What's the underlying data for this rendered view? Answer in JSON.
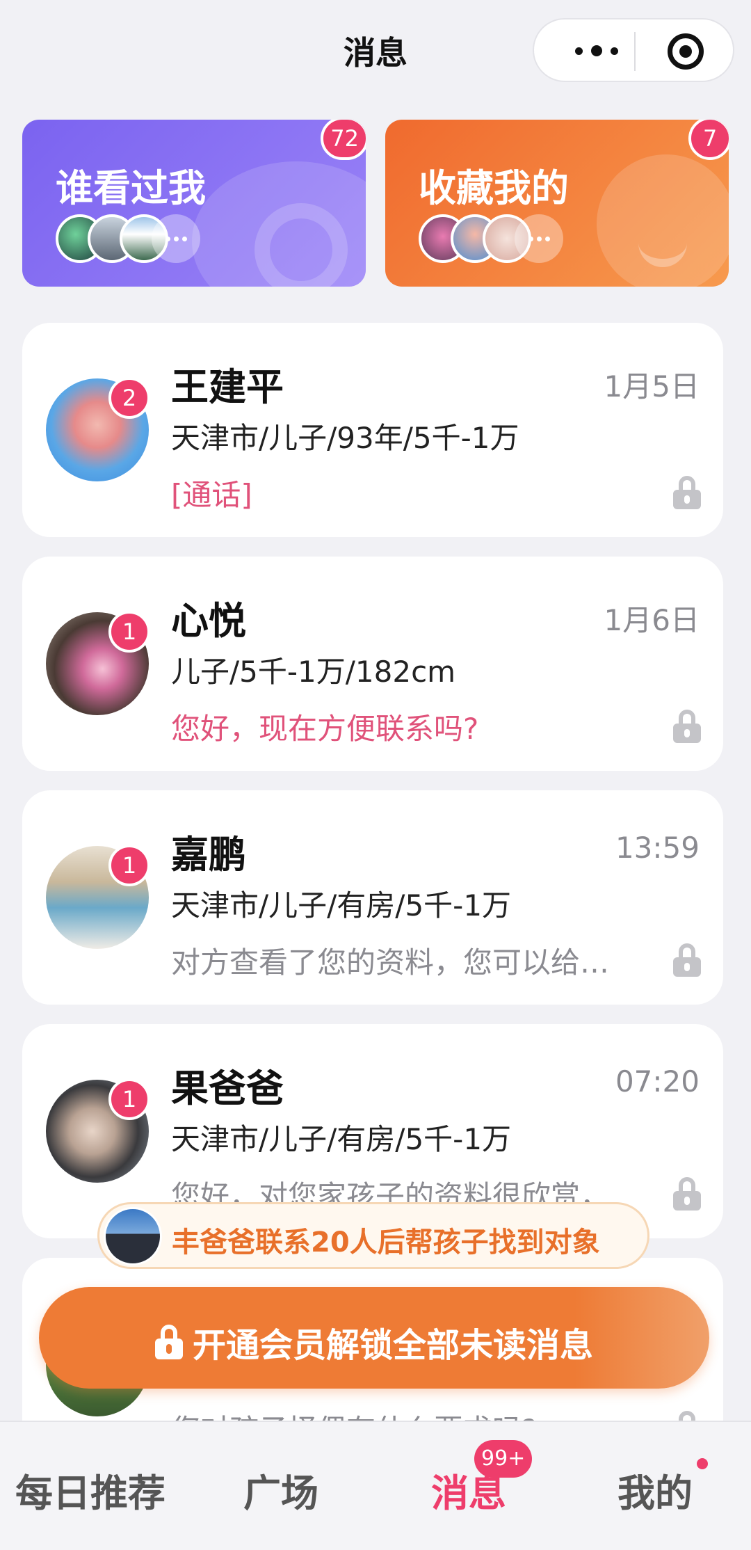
{
  "header": {
    "title": "消息"
  },
  "cards": {
    "visitors": {
      "title": "谁看过我",
      "count": "72"
    },
    "favorites": {
      "title": "收藏我的",
      "count": "7"
    }
  },
  "messages": [
    {
      "name": "王建平",
      "time": "1月5日",
      "info": "天津市/儿子/93年/5千-1万",
      "preview": "[通话]",
      "unread": "2"
    },
    {
      "name": "心悦",
      "time": "1月6日",
      "info": "儿子/5千-1万/182cm",
      "preview": "您好，现在方便联系吗?",
      "unread": "1"
    },
    {
      "name": "嘉鹏",
      "time": "13:59",
      "info": "天津市/儿子/有房/5千-1万",
      "preview": "对方查看了您的资料，您可以给…",
      "unread": "1"
    },
    {
      "name": "果爸爸",
      "time": "07:20",
      "info": "天津市/儿子/有房/5千-1万",
      "preview": "您好，对您家孩子的资料很欣赏，",
      "unread": "1"
    }
  ],
  "partial_message": {
    "preview": "您对孩子择偶有什么要求吗?"
  },
  "promo": {
    "text": "丰爸爸联系20人后帮孩子找到对象"
  },
  "vip_button": {
    "label": "开通会员解锁全部未读消息"
  },
  "tabbar": {
    "items": [
      "每日推荐",
      "广场",
      "消息",
      "我的"
    ],
    "active_index": 2,
    "message_badge": "99+"
  },
  "colors": {
    "accent_pink": "#ee3d6b",
    "accent_orange": "#ee7b35",
    "purple": "#7b63f0"
  }
}
